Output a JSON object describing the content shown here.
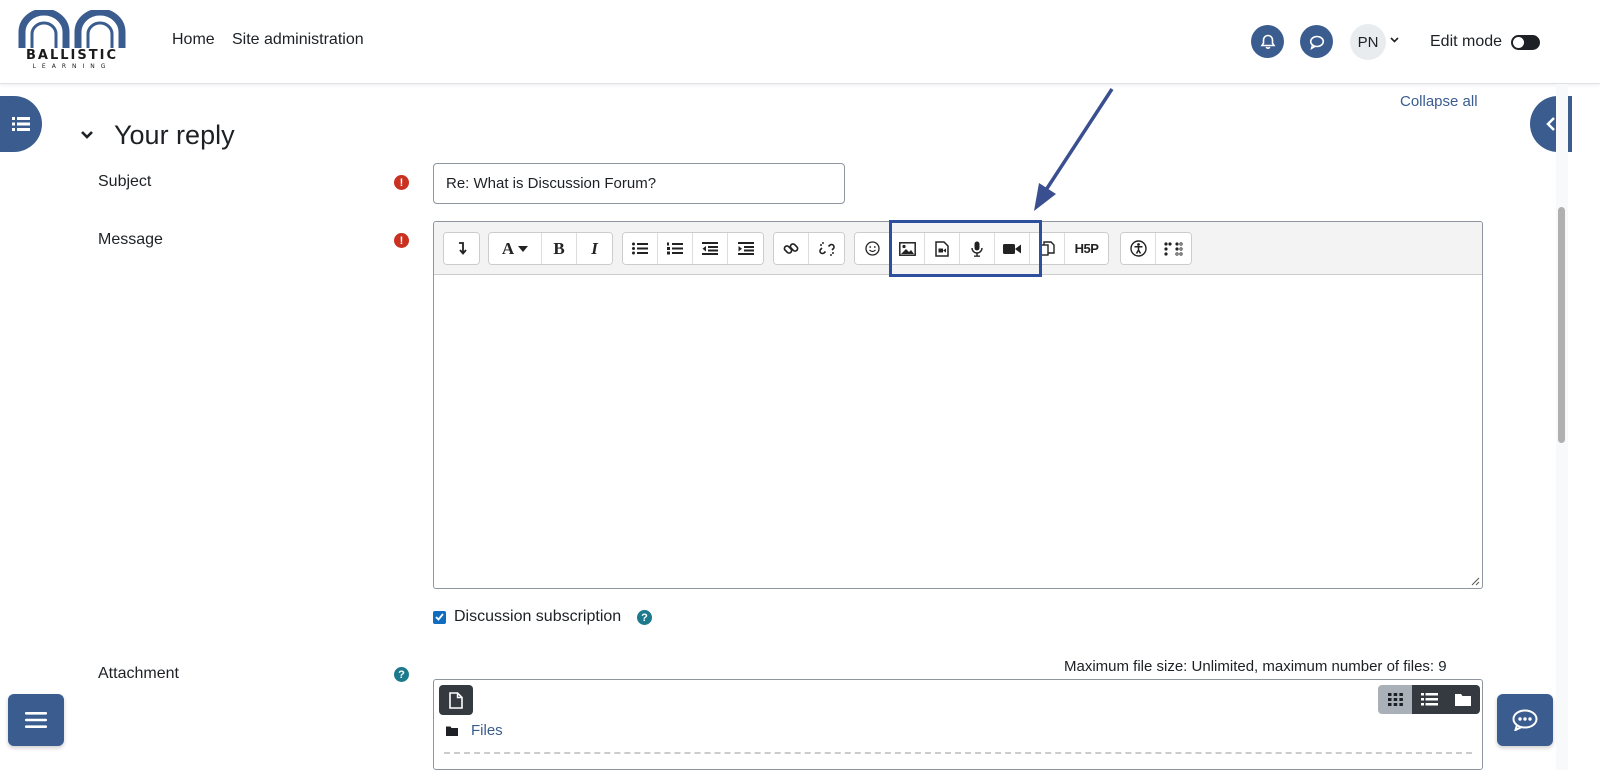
{
  "brand": {
    "name": "BALLISTIC",
    "tagline": "LEARNING"
  },
  "nav": {
    "home": "Home",
    "site_admin": "Site administration"
  },
  "user": {
    "initials": "PN",
    "caret": "⌄"
  },
  "edit_mode": {
    "label": "Edit mode",
    "enabled": false
  },
  "collapse_all": "Collapse all",
  "section": {
    "title": "Your reply"
  },
  "form": {
    "subject_label": "Subject",
    "subject_value": "Re: What is Discussion Forum?",
    "message_label": "Message",
    "required_mark": "!",
    "subscription_label": "Discussion subscription",
    "subscription_checked": true,
    "attachment_label": "Attachment",
    "help_mark": "?",
    "max_file_text": "Maximum file size: Unlimited, maximum number of files: 9",
    "files_folder": "Files"
  },
  "toolbar": {
    "font_label": "A",
    "bold": "B",
    "italic": "I",
    "h5p": "H5P"
  },
  "colors": {
    "brand_blue": "#3a5c8f",
    "highlight": "#2c4f9e",
    "required": "#ca3120",
    "help": "#1d7a8c"
  }
}
